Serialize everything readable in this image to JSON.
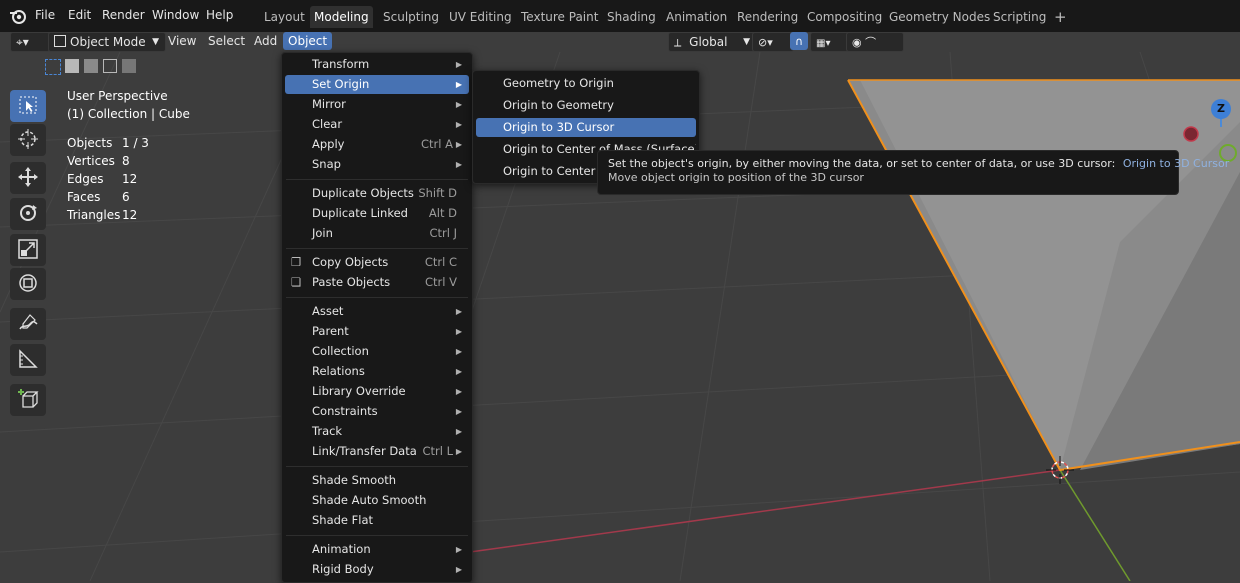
{
  "topbar": {
    "menus": [
      "File",
      "Edit",
      "Render",
      "Window",
      "Help"
    ],
    "workspaces": [
      "Layout",
      "Modeling",
      "Sculpting",
      "UV Editing",
      "Texture Paint",
      "Shading",
      "Animation",
      "Rendering",
      "Compositing",
      "Geometry Nodes",
      "Scripting"
    ],
    "active_workspace": "Modeling",
    "add_tab": "+"
  },
  "header": {
    "mode": "Object Mode",
    "menus": [
      "View",
      "Select",
      "Add",
      "Object"
    ],
    "active_menu": "Object",
    "transform_orientation": "Global"
  },
  "overlay": {
    "perspective": "User Perspective",
    "collection": "(1) Collection | Cube",
    "stats": [
      {
        "label": "Objects",
        "value": "1 / 3"
      },
      {
        "label": "Vertices",
        "value": "8"
      },
      {
        "label": "Edges",
        "value": "12"
      },
      {
        "label": "Faces",
        "value": "6"
      },
      {
        "label": "Triangles",
        "value": "12"
      }
    ]
  },
  "object_menu": {
    "groups": [
      [
        {
          "label": "Transform",
          "submenu": true
        },
        {
          "label": "Set Origin",
          "submenu": true,
          "highlighted": true
        },
        {
          "label": "Mirror",
          "submenu": true
        },
        {
          "label": "Clear",
          "submenu": true
        },
        {
          "label": "Apply",
          "shortcut": "Ctrl A",
          "submenu": true
        },
        {
          "label": "Snap",
          "submenu": true
        }
      ],
      [
        {
          "label": "Duplicate Objects",
          "shortcut": "Shift D"
        },
        {
          "label": "Duplicate Linked",
          "shortcut": "Alt D"
        },
        {
          "label": "Join",
          "shortcut": "Ctrl J"
        }
      ],
      [
        {
          "label": "Copy Objects",
          "shortcut": "Ctrl C",
          "icon": "copy-icon"
        },
        {
          "label": "Paste Objects",
          "shortcut": "Ctrl V",
          "icon": "paste-icon"
        }
      ],
      [
        {
          "label": "Asset",
          "submenu": true
        },
        {
          "label": "Parent",
          "submenu": true
        },
        {
          "label": "Collection",
          "submenu": true
        },
        {
          "label": "Relations",
          "submenu": true
        },
        {
          "label": "Library Override",
          "submenu": true
        },
        {
          "label": "Constraints",
          "submenu": true
        },
        {
          "label": "Track",
          "submenu": true
        },
        {
          "label": "Link/Transfer Data",
          "shortcut": "Ctrl L",
          "submenu": true
        }
      ],
      [
        {
          "label": "Shade Smooth"
        },
        {
          "label": "Shade Auto Smooth"
        },
        {
          "label": "Shade Flat"
        }
      ],
      [
        {
          "label": "Animation",
          "submenu": true
        },
        {
          "label": "Rigid Body",
          "submenu": true
        }
      ]
    ]
  },
  "set_origin_menu": {
    "items": [
      {
        "label": "Geometry to Origin"
      },
      {
        "label": "Origin to Geometry"
      },
      {
        "label": "Origin to 3D Cursor",
        "highlighted": true
      },
      {
        "label": "Origin to Center of Mass (Surface)"
      },
      {
        "label": "Origin to Center of Mass (Volume)"
      }
    ]
  },
  "tooltip": {
    "description": "Set the object's origin, by either moving the data, or set to center of data, or use 3D cursor:",
    "operator": "Origin to 3D Cursor",
    "detail": "Move object origin to position of the 3D cursor"
  },
  "gizmo": {
    "z_label": "Z"
  },
  "colors": {
    "accent": "#4772b3",
    "menu_bg": "#181818",
    "viewport_bg": "#3d3d3d",
    "selection_outline": "#f0901c"
  }
}
